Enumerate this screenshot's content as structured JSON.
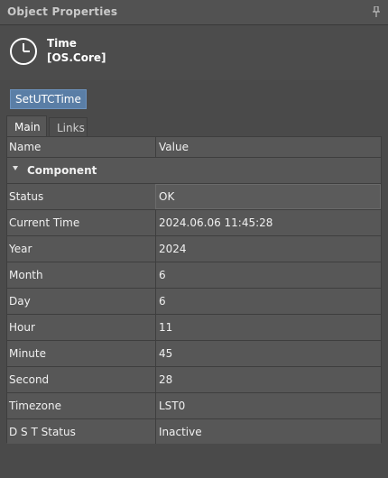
{
  "panel": {
    "title": "Object Properties",
    "pin_icon": "pin-icon"
  },
  "object": {
    "name": "Time",
    "type": "[OS.Core]",
    "icon": "clock-icon"
  },
  "actions": {
    "set_utc_label": "SetUTCTime"
  },
  "tabs": [
    {
      "label": "Main",
      "active": true
    },
    {
      "label": "Links",
      "active": false
    }
  ],
  "grid": {
    "headers": {
      "name": "Name",
      "value": "Value"
    },
    "group": {
      "label": "Component",
      "expanded": true
    },
    "rows": [
      {
        "name": "Status",
        "value": "OK",
        "selected": true
      },
      {
        "name": "Current Time",
        "value": "2024.06.06 11:45:28"
      },
      {
        "name": "Year",
        "value": "2024"
      },
      {
        "name": "Month",
        "value": "6"
      },
      {
        "name": "Day",
        "value": "6"
      },
      {
        "name": "Hour",
        "value": "11"
      },
      {
        "name": "Minute",
        "value": "45"
      },
      {
        "name": "Second",
        "value": "28"
      },
      {
        "name": "Timezone",
        "value": "LST0"
      },
      {
        "name": "D S T Status",
        "value": "Inactive"
      }
    ]
  },
  "colors": {
    "button_accent": "#5a7ea6",
    "panel_bg": "#4a4a4a",
    "row_bg": "#575757"
  }
}
